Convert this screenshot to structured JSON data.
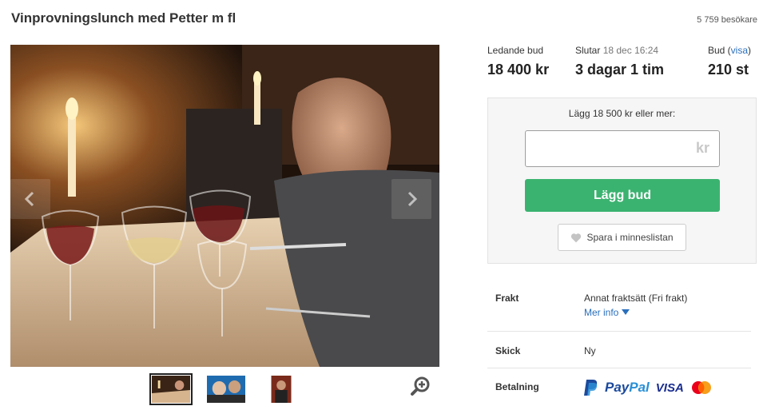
{
  "listing": {
    "title": "Vinprovningslunch med Petter m fl",
    "visitors": "5 759 besökare"
  },
  "gallery": {
    "active_index": 0,
    "thumbnails": [
      "thumbnail-1",
      "thumbnail-2",
      "thumbnail-3"
    ]
  },
  "stats": {
    "leading_bid_label": "Ledande bud",
    "leading_bid_value": "18 400 kr",
    "ends_label": "Slutar",
    "ends_date": "18 dec 16:24",
    "ends_value": "3 dagar 1 tim",
    "bids_label": "Bud",
    "bids_link": "visa",
    "bids_value": "210 st"
  },
  "bid": {
    "prompt": "Lägg 18 500 kr eller mer:",
    "input_value": "",
    "currency": "kr",
    "button_label": "Lägg bud",
    "save_label": "Spara i minneslistan"
  },
  "details": {
    "shipping_label": "Frakt",
    "shipping_value": "Annat fraktsätt (Fri frakt)",
    "more_info": "Mer info",
    "condition_label": "Skick",
    "condition_value": "Ny",
    "payment_label": "Betalning",
    "payment_paypal_1": "Pay",
    "payment_paypal_2": "Pal",
    "payment_visa": "VISA"
  },
  "colors": {
    "accent_green": "#3bb370",
    "link_blue": "#2a6fbd",
    "paypal_dark": "#1c4a9c",
    "paypal_light": "#2a8fd6"
  }
}
